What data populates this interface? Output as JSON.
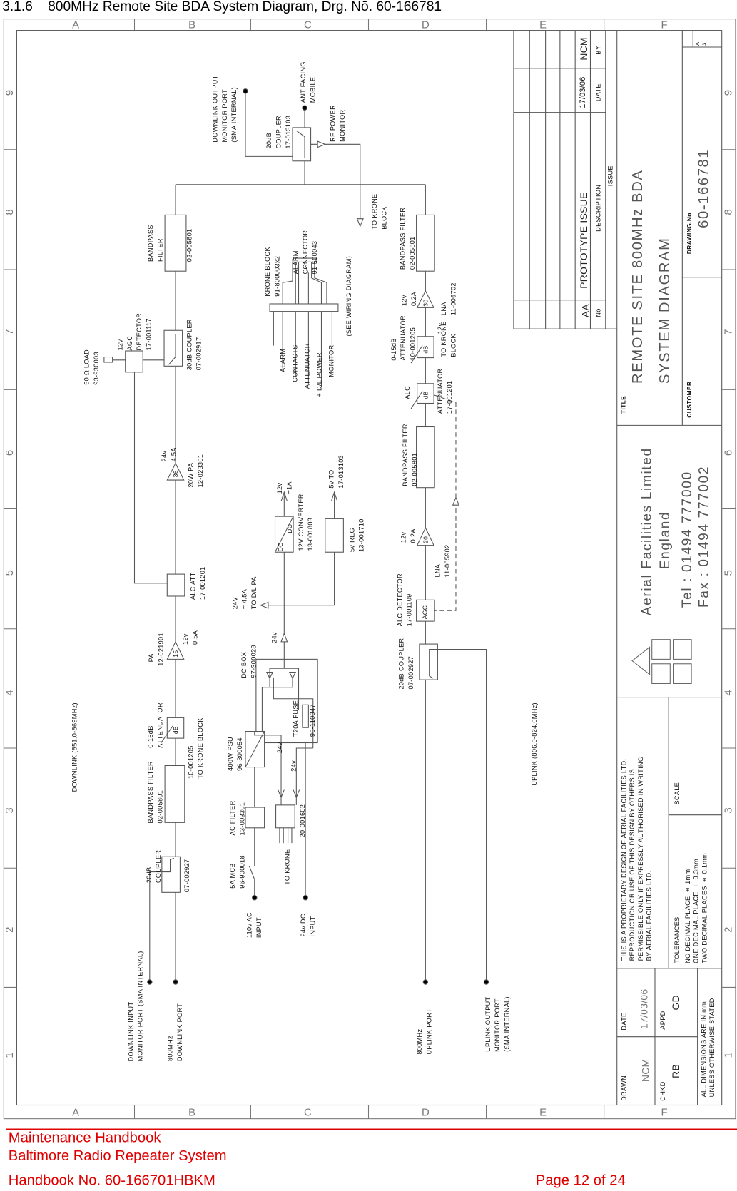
{
  "header": {
    "title": "3.1.6    800MHz Remote Site BDA System Diagram, Drg. Nō. 60-166781"
  },
  "footer": {
    "line1": "Maintenance Handbook",
    "line2": "Baltimore Radio Repeater System",
    "handbook_no": "Handbook No. 60-166701HBKM",
    "page": "Page 12 of 24",
    "accent_color": "#e00000"
  },
  "ruler": {
    "letters": [
      "A",
      "B",
      "C",
      "D",
      "E",
      "F"
    ],
    "numbers": [
      "9",
      "8",
      "7",
      "6",
      "5",
      "4",
      "3",
      "2",
      "1"
    ]
  },
  "downlink": {
    "band": "DOWNLINK (851.0-869MHz)",
    "output_port": "DOWNLINK OUTPUT\nMONITOR PORT\n(SMA INTERNAL)",
    "coupler_top": "20dB\nCOUPLER\n17-013103",
    "ant": "ANT FACING\nMOBILE",
    "rf_power": "RF POWER\nMONITOR",
    "to_krone": "TO KRONE\nBLOCK",
    "bpf_top": "BANDPASS\nFILTER",
    "bpf_top_pn": "02-005801",
    "load": "50 Ω LOAD\n93-930003",
    "agc_det": "12v\nAGC\nDETECTOR\n17-001117",
    "coupler30": "30dB COUPLER\n07-002917",
    "pa_power": "24v\n4.5A",
    "pa_gain": "36",
    "pa": "20W PA\n12-023301",
    "alc_att": "ALC ATT\n17-001201",
    "lpa": "LPA\n12-021901",
    "lpa_gain": "15",
    "lpa_power": "12v\n0.5A",
    "att": "0-15dB\nATTENUATOR",
    "att_box": "dB",
    "att_pn": "10-001205\nTO KRONE BLOCK",
    "bpf_bottom": "BANDPASS FILTER\n02-005801",
    "coupler_bottom": "20dB\nCOUPLER",
    "coupler_bottom_pn": "07-002927",
    "input_monitor": "DOWNLINK INPUT\nMONITOR PORT (SMA INTERNAL)",
    "port": "800MHz\nDOWNLINK PORT"
  },
  "krone": {
    "block": "KRONE BLOCK\n91-800003x2",
    "connector": "ALARM\nCONNECTOR\n91-500043",
    "wires": [
      "ALARM",
      "CONTACTS",
      "ATTENUATOR",
      "+ D/L POWER",
      "MONITOR"
    ],
    "note": "(SEE WIRING DIAGRAM)"
  },
  "power": {
    "out12": "12v\n≈1A",
    "out5": "5v TO\n17-013103",
    "conv": "12V CONVERTER\n13-001803",
    "conv_dc1": "DC",
    "conv_dc2": "DC",
    "reg": "5v REG\n13-001710",
    "to_pa": "24V\n≈ 4.5A\nTO D/L PA",
    "v24": "24v",
    "dcbox": "DC BOX\n97-300028",
    "fuse": "T20A FUSE",
    "fuse_pn": "96-110047",
    "psu": "400W PSU\n96-300054",
    "v24a": "24v",
    "v24b": "24v",
    "acfilter": "AC FILTER\n13-003301",
    "term": "20-001602",
    "mcb": "5A MCB\n96-900018",
    "to_krone": "TO KRONE",
    "ac_input": "110v AC\nINPUT",
    "dc_input": "24v DC\nINPUT"
  },
  "uplink": {
    "band": "UPLINK (806.0-824.0MHz)",
    "bpf1": "BANDPASS FILTER\n02-005801",
    "lna1_power": "12v\n0.2A",
    "lna1_gain": "30",
    "lna1": "LNA\n11-006702",
    "att": "0-15dB\nATTENUATOR\n10-001205",
    "att_power": "12v",
    "att_box": "dB",
    "to_krone": "TO KRONE\nBLOCK",
    "alc": "ALC",
    "alc_box": "dB",
    "alc_att": "ATTENUATOR\n17-001201",
    "bpf2": "BANDPASS FILTER\n02-005801",
    "lna2_power": "12v\n0.2A",
    "lna2_gain": "20",
    "lna2": "LNA\n11-005902",
    "alc_det": "ALC DETECTOR\n17-001109",
    "agc_box": "AGC",
    "coupler": "20dB COUPLER\n07-002927",
    "port": "800MHz\nUPLINK PORT",
    "output_monitor": "UPLINK OUTPUT\nMONITOR PORT\n(SMA INTERNAL)"
  },
  "revisions": {
    "row": {
      "no": "AA",
      "description": "PROTOTYPE ISSUE",
      "date": "17/03/06",
      "by": "NCM"
    },
    "headers": {
      "no": "No",
      "description": "DESCRIPTION",
      "date": "DATE",
      "by": "BY"
    },
    "label": "ISSUE"
  },
  "titleblock": {
    "title_label": "TITLE",
    "title": "REMOTE SITE 800MHz BDA\nSYSTEM DIAGRAM",
    "customer_label": "CUSTOMER",
    "drawing_no_label": "DRAWING.No",
    "drawing_no": "60-166781",
    "size": "A\n3",
    "company": "Aerial Facilities Limited",
    "country": "England",
    "tel": "Tel : 01494 777000",
    "fax": "Fax : 01494 777002",
    "proprietary": "THIS IS A PROPRIETARY DESIGN OF AERIAL FACILITIES LTD.\nREPRODUCTION OR USE OF THIS DESIGN BY OTHERS IS\nPERMISSIBLE ONLY IF EXPRESSLY AUTHORISED IN WRITING\nBY AERIAL FACILITIES LTD.",
    "scale_label": "SCALE",
    "tolerances_label": "TOLERANCES",
    "tolerances": "NO DECIMAL PLACE ± 1mm\nONE DECIMAL PLACE ± 0.3mm\nTWO DECIMAL PLACES ± 0.1mm",
    "drawn_label": "DRAWN",
    "drawn": "NCM",
    "date_label": "DATE",
    "date": "17/03/06",
    "chkd_label": "CHKD",
    "chkd": "RB",
    "appd_label": "APPD",
    "appd": "GD",
    "dimensions": "ALL DIMENSIONS ARE IN mm\nUNLESS OTHERWISE STATED"
  }
}
